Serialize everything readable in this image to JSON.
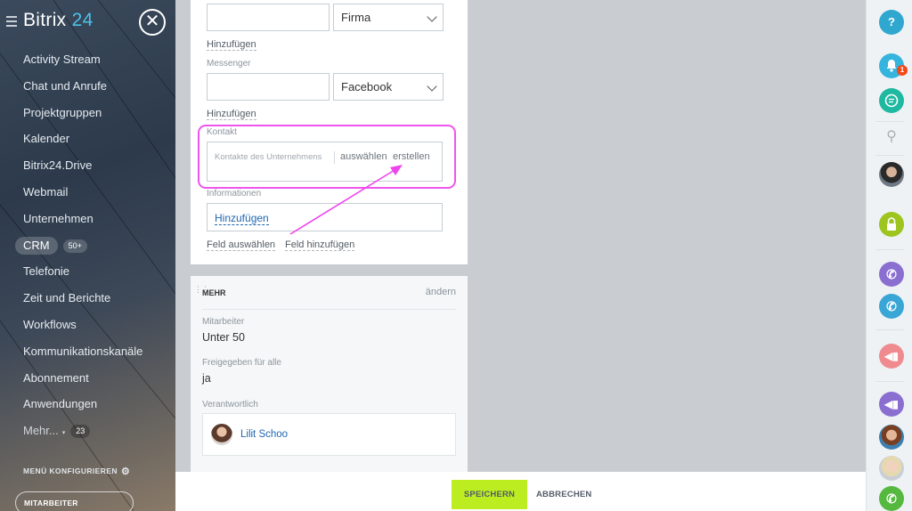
{
  "app": {
    "logo_text": "Bitrix",
    "logo_number": "24"
  },
  "sidebar": {
    "items": [
      {
        "label": "Activity Stream"
      },
      {
        "label": "Chat und Anrufe"
      },
      {
        "label": "Projektgruppen"
      },
      {
        "label": "Kalender"
      },
      {
        "label": "Bitrix24.Drive"
      },
      {
        "label": "Webmail"
      },
      {
        "label": "Unternehmen"
      },
      {
        "label": "CRM",
        "counter": "50+"
      },
      {
        "label": "Telefonie"
      },
      {
        "label": "Zeit und Berichte"
      },
      {
        "label": "Workflows"
      },
      {
        "label": "Kommunikationskanäle"
      },
      {
        "label": "Abonnement"
      },
      {
        "label": "Anwendungen"
      },
      {
        "label": "Mehr...",
        "counter": "23"
      }
    ],
    "configure_label": "MENÜ KONFIGURIEREN",
    "invite_label": "MITARBEITER EINLADEN"
  },
  "form": {
    "company_select": "Firma",
    "add_label_1": "Hinzufügen",
    "messenger_label": "Messenger",
    "messenger_select": "Facebook",
    "add_label_2": "Hinzufügen",
    "contact_label": "Kontakt",
    "contact_placeholder": "Kontakte des Unternehmens",
    "contact_select": "auswählen",
    "contact_create": "erstellen",
    "info_label": "Informationen",
    "info_add": "Hinzufügen",
    "select_field": "Feld auswählen",
    "add_field": "Feld hinzufügen"
  },
  "more_section": {
    "title": "MEHR",
    "edit": "ändern",
    "employees_label": "Mitarbeiter",
    "employees_value": "Unter 50",
    "shared_label": "Freigegeben für alle",
    "shared_value": "ja",
    "responsible_label": "Verantwortlich",
    "responsible_name": "Lilit Schoo"
  },
  "actions": {
    "save": "SPEICHERN",
    "cancel": "ABBRECHEN"
  },
  "rightbar": {
    "help": "?",
    "notification_count": "1"
  },
  "colors": {
    "accent_green": "#bbed21",
    "highlight_magenta": "#ee55ee",
    "link_blue": "#2067b0"
  }
}
